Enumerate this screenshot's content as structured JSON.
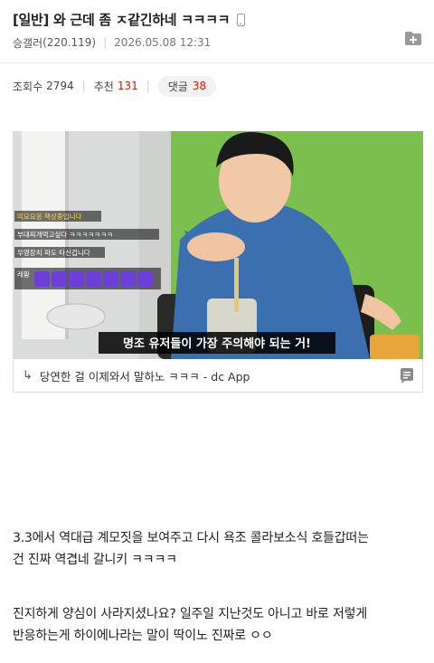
{
  "post": {
    "title": "[일반] 와 근데 좀 ㅈ같긴하네 ㅋㅋㅋㅋ",
    "author": "승갤러",
    "ip": "(220.119)",
    "date": "2026.05.08 12:31"
  },
  "stats": {
    "views_label": "조회수",
    "views": "2794",
    "recommend_label": "추천",
    "recommend": "131",
    "comments_label": "댓글",
    "comments": "38"
  },
  "video": {
    "caption": "명조 유저들이 가장 주의해야 되는 거!",
    "chat": [
      "띠요요옹 팩상중입니다",
      "부대찌개먹고싶다 ㅋㅋㅋㅋㅋㅋㅋ",
      "우영장치 파도 타신겁니다",
      "레황"
    ],
    "emote": "OO"
  },
  "link": {
    "arrow": "↳",
    "text": "당연한 걸 이제와서 말하노 ㅋㅋㅋ - dc App"
  },
  "content": {
    "p1_line1": "3.3에서 역대급 계모짓을 보여주고 다시 욕조 콜라보소식 호들갑떠는",
    "p1_line2": "건 진짜 역겹네 갈니키 ㅋㅋㅋㅋ",
    "p2_line1": "진지하게 양심이 사라지셨나요? 일주일 지난것도 아니고 바로 저렇게",
    "p2_line2": "반응하는게 하이에나라는 말이 딱이노 진짜로 ㅇㅇ"
  },
  "colors": {
    "accent_red": "#d31900",
    "video_wall": "#7bc04e",
    "shirt": "#3b6fb0"
  }
}
